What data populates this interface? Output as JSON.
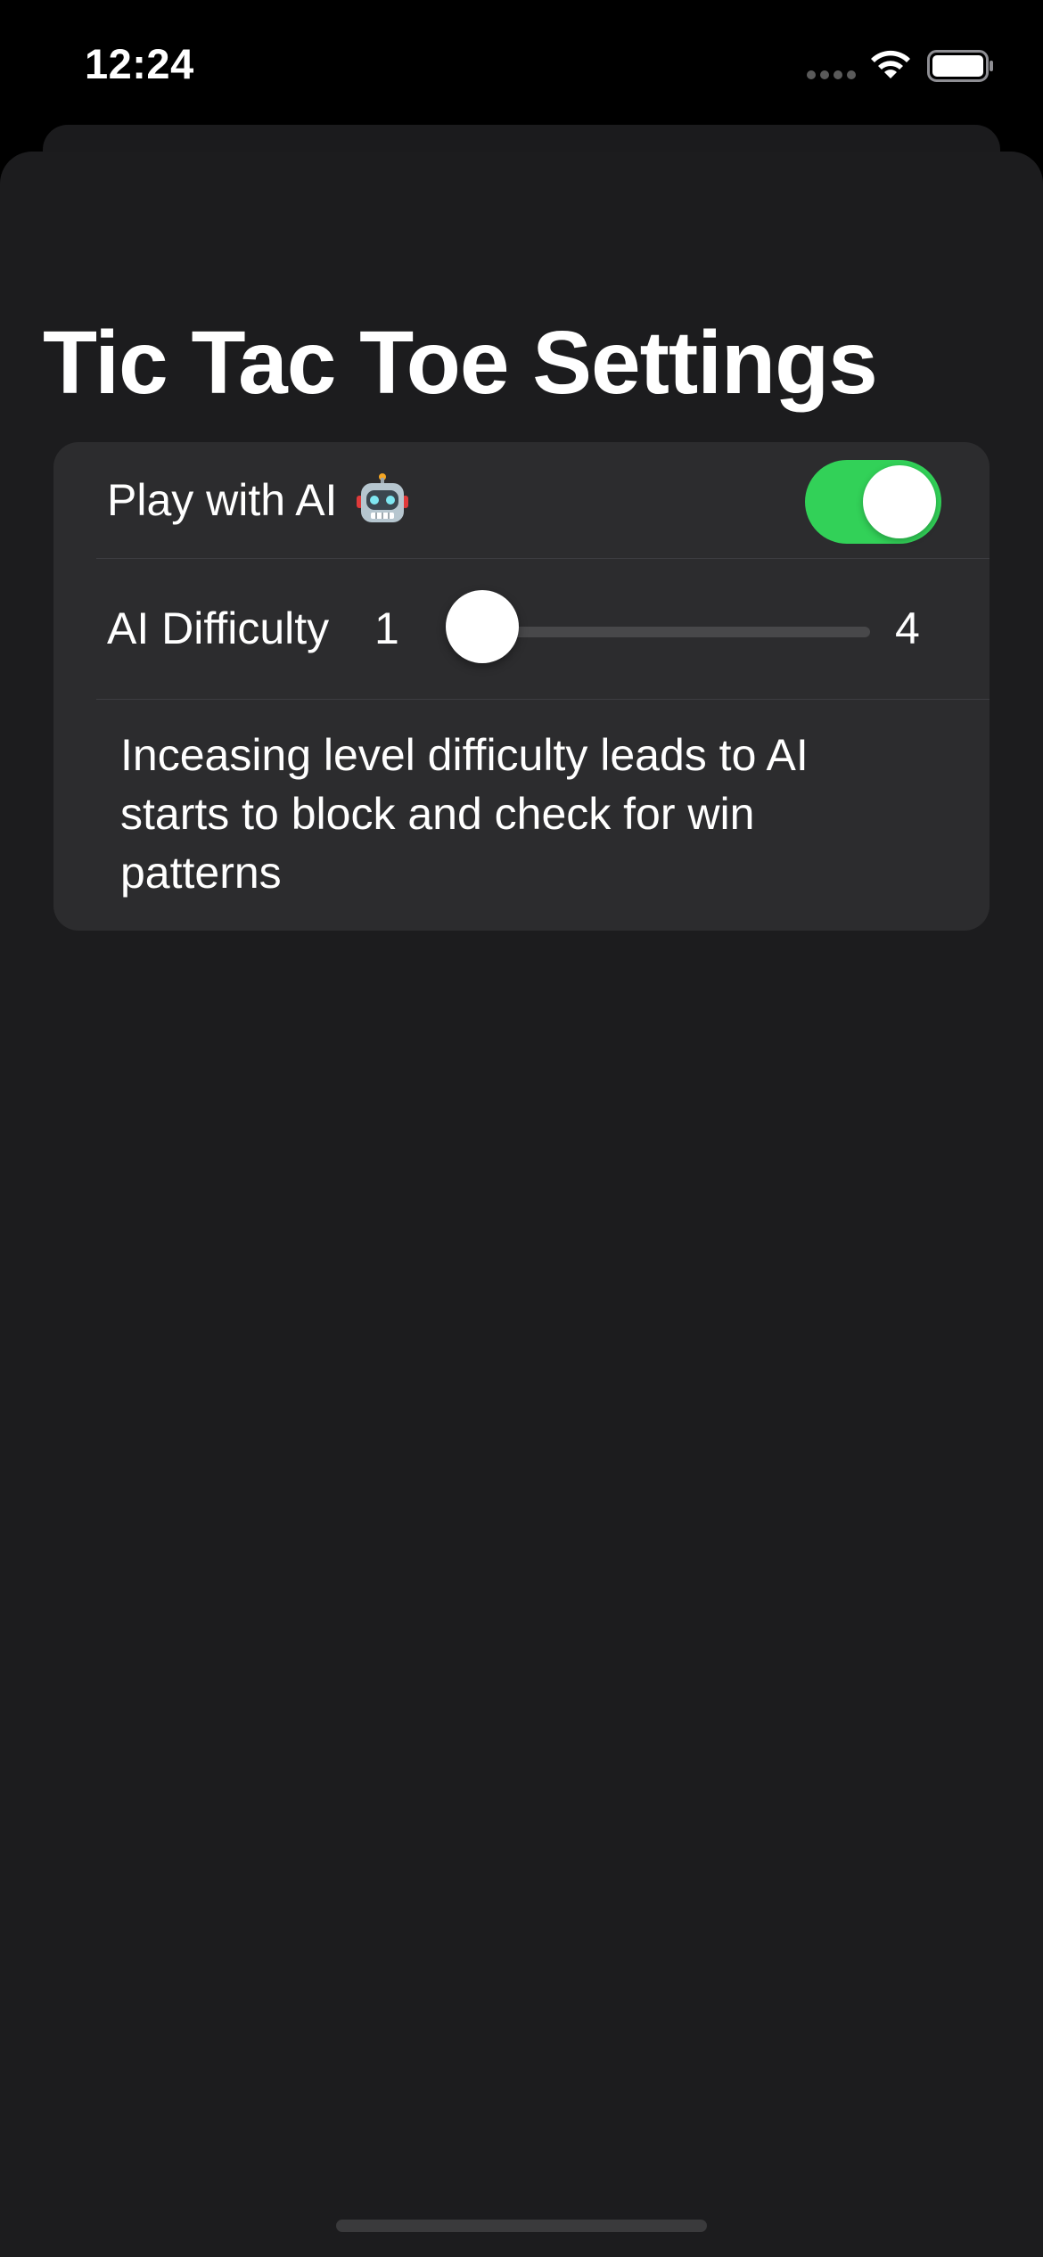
{
  "status_bar": {
    "time": "12:24"
  },
  "header": {
    "title": "Tic Tac Toe Settings"
  },
  "settings": {
    "play_with_ai": {
      "label": "Play with AI",
      "icon": "robot-icon",
      "enabled": true
    },
    "ai_difficulty": {
      "label": "AI Difficulty",
      "min_label": "1",
      "max_label": "4",
      "min": 1,
      "max": 4,
      "value": 1
    },
    "description": "Inceasing level difficulty leads to AI starts to block and check for win patterns"
  },
  "colors": {
    "accent_green": "#32d158",
    "background": "#1c1c1e",
    "card": "#2c2c2e"
  }
}
